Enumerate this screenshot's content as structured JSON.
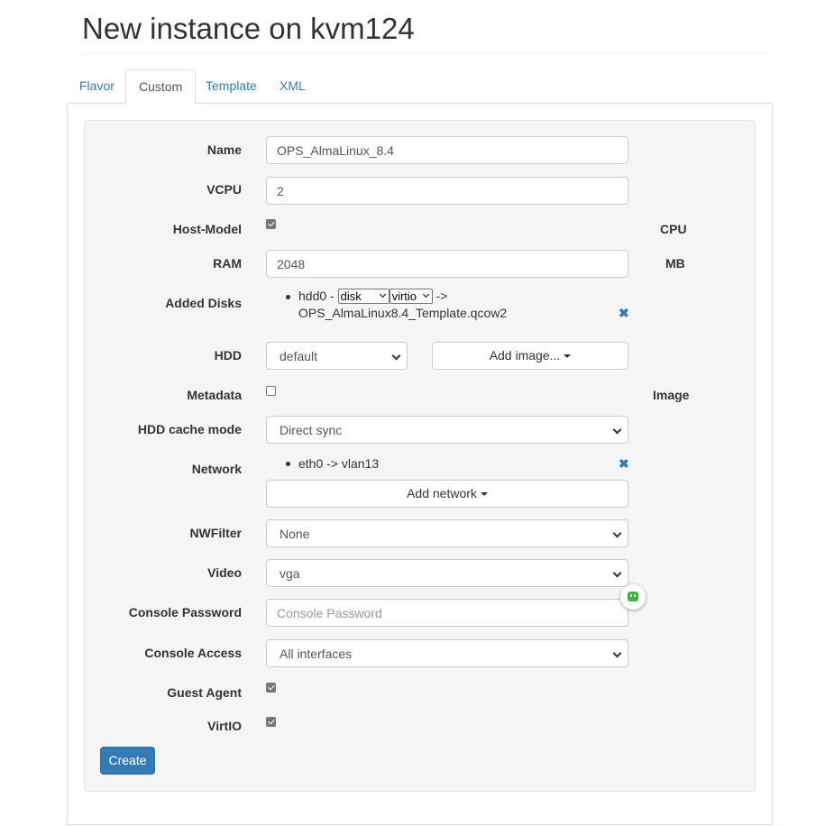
{
  "page": {
    "title": "New instance on kvm124"
  },
  "tabs": [
    {
      "label": "Flavor"
    },
    {
      "label": "Custom",
      "active": true
    },
    {
      "label": "Template"
    },
    {
      "label": "XML"
    }
  ],
  "form": {
    "name": {
      "label": "Name",
      "value": "OPS_AlmaLinux_8.4"
    },
    "vcpu": {
      "label": "VCPU",
      "value": "2"
    },
    "host_model": {
      "label": "Host-Model",
      "checked": true,
      "unit": "CPU"
    },
    "ram": {
      "label": "RAM",
      "value": "2048",
      "unit": "MB"
    },
    "added_disks": {
      "label": "Added Disks",
      "items": [
        {
          "name": "hdd0 -",
          "type": "disk",
          "bus": "virtio",
          "arrow": "->",
          "file": "OPS_AlmaLinux8.4_Template.qcow2",
          "remove": "✖"
        }
      ]
    },
    "hdd": {
      "label": "HDD",
      "value": "default",
      "add_image_label": "Add image..."
    },
    "metadata": {
      "label": "Metadata",
      "checked": false,
      "side_label": "Image"
    },
    "hdd_cache_mode": {
      "label": "HDD cache mode",
      "value": "Direct sync"
    },
    "network": {
      "label": "Network",
      "items": [
        {
          "text": "eth0 -> vlan13",
          "remove": "✖"
        }
      ],
      "add_label": "Add network"
    },
    "nwfilter": {
      "label": "NWFilter",
      "value": "None"
    },
    "video": {
      "label": "Video",
      "value": "vga"
    },
    "console_password": {
      "label": "Console Password",
      "value": "",
      "placeholder": "Console Password"
    },
    "console_access": {
      "label": "Console Access",
      "value": "All interfaces"
    },
    "guest_agent": {
      "label": "Guest Agent",
      "checked": true
    },
    "virtio": {
      "label": "VirtIO",
      "checked": true
    },
    "create_label": "Create"
  },
  "colors": {
    "link": "#337ab7",
    "primary": "#337ab7",
    "well": "#f5f5f5",
    "extension": "#3cb043"
  },
  "icons": {
    "remove": "close-icon",
    "caret": "caret-down-icon",
    "extension": "extension-robot-icon"
  }
}
